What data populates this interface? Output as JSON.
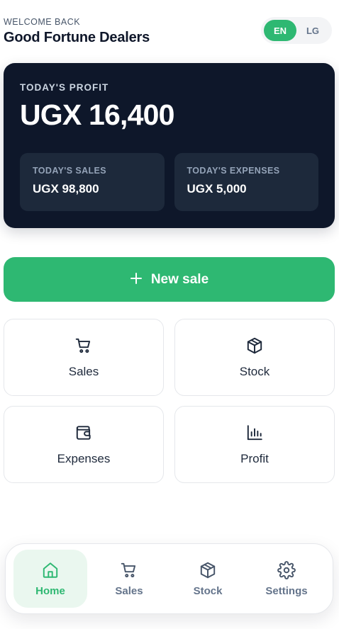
{
  "header": {
    "welcome": "WELCOME BACK",
    "business_name": "Good Fortune Dealers",
    "languages": [
      {
        "code": "EN",
        "active": true
      },
      {
        "code": "LG",
        "active": false
      }
    ]
  },
  "profit_card": {
    "label": "TODAY'S PROFIT",
    "value": "UGX 16,400",
    "sales": {
      "label": "TODAY'S SALES",
      "value": "UGX 98,800"
    },
    "expenses": {
      "label": "TODAY'S EXPENSES",
      "value": "UGX 5,000"
    }
  },
  "new_sale": {
    "icon": "plus-icon",
    "label": "New sale"
  },
  "tiles": [
    {
      "icon": "cart-icon",
      "label": "Sales"
    },
    {
      "icon": "box-icon",
      "label": "Stock"
    },
    {
      "icon": "wallet-icon",
      "label": "Expenses"
    },
    {
      "icon": "bar-chart-icon",
      "label": "Profit"
    }
  ],
  "bottom_nav": [
    {
      "icon": "home-icon",
      "label": "Home",
      "active": true
    },
    {
      "icon": "cart-icon",
      "label": "Sales",
      "active": false
    },
    {
      "icon": "box-icon",
      "label": "Stock",
      "active": false
    },
    {
      "icon": "gear-icon",
      "label": "Settings",
      "active": false
    }
  ],
  "colors": {
    "accent": "#2eb872",
    "card_dark": "#0e172a",
    "subcard": "#1d293b",
    "nav_active_bg": "#eaf7ef",
    "text_muted": "#64748b"
  }
}
